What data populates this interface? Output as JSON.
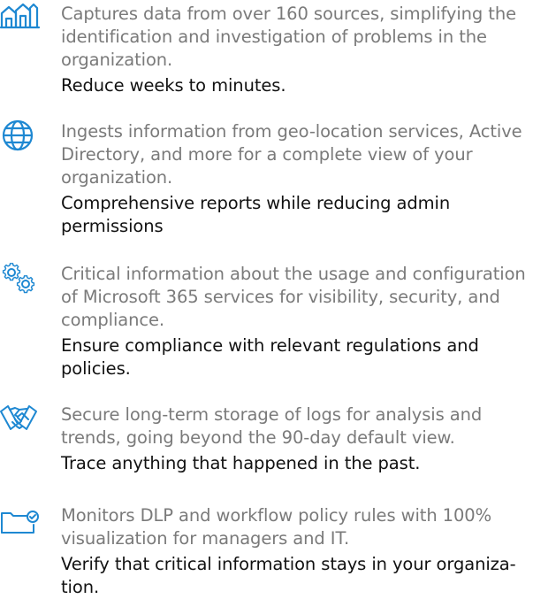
{
  "accent_color": "#1e88d2",
  "features": [
    {
      "icon": "buildings-icon",
      "description": "Captures data from over 160 sources, simplifying the identification and investigation of problems in the organization.",
      "benefit": "Reduce weeks to minutes."
    },
    {
      "icon": "globe-icon",
      "description": "Ingests information from geo-location services, Active Directory, and more for a complete view of your organization.",
      "benefit": "Comprehensive reports while reducing admin permissions"
    },
    {
      "icon": "gears-icon",
      "description": "Critical information about the usage and configuration of Microsoft 365 services for visibility, security, and compliance.",
      "benefit": "Ensure compliance with relevant regulations and policies."
    },
    {
      "icon": "handshake-icon",
      "description": "Secure long-term storage of logs for analysis and trends, going beyond the 90-day default view.",
      "benefit": "Trace anything that happened in the past."
    },
    {
      "icon": "folder-check-icon",
      "description": "Monitors DLP and workflow policy rules with 100% visualization for managers and IT.",
      "benefit": "Verify that critical information stays in your organiza-tion."
    }
  ]
}
